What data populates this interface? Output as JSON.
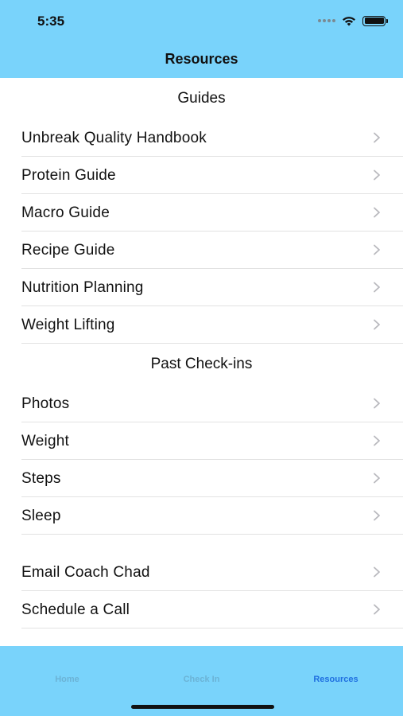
{
  "status_bar": {
    "time": "5:35"
  },
  "nav": {
    "title": "Resources"
  },
  "sections": {
    "guides": {
      "header": "Guides",
      "items": [
        "Unbreak Quality Handbook",
        "Protein Guide",
        "Macro Guide",
        "Recipe Guide",
        "Nutrition Planning",
        "Weight Lifting"
      ]
    },
    "past_checkins": {
      "header": "Past Check-ins",
      "items": [
        "Photos",
        "Weight",
        "Steps",
        "Sleep"
      ]
    },
    "contact": {
      "items": [
        "Email Coach Chad",
        "Schedule a Call"
      ]
    }
  },
  "tab_bar": {
    "tabs": [
      "Home",
      "Check In",
      "Resources"
    ],
    "active": "Resources"
  },
  "colors": {
    "bar": "#79d3fb",
    "active_tab": "#1f6fe0"
  }
}
